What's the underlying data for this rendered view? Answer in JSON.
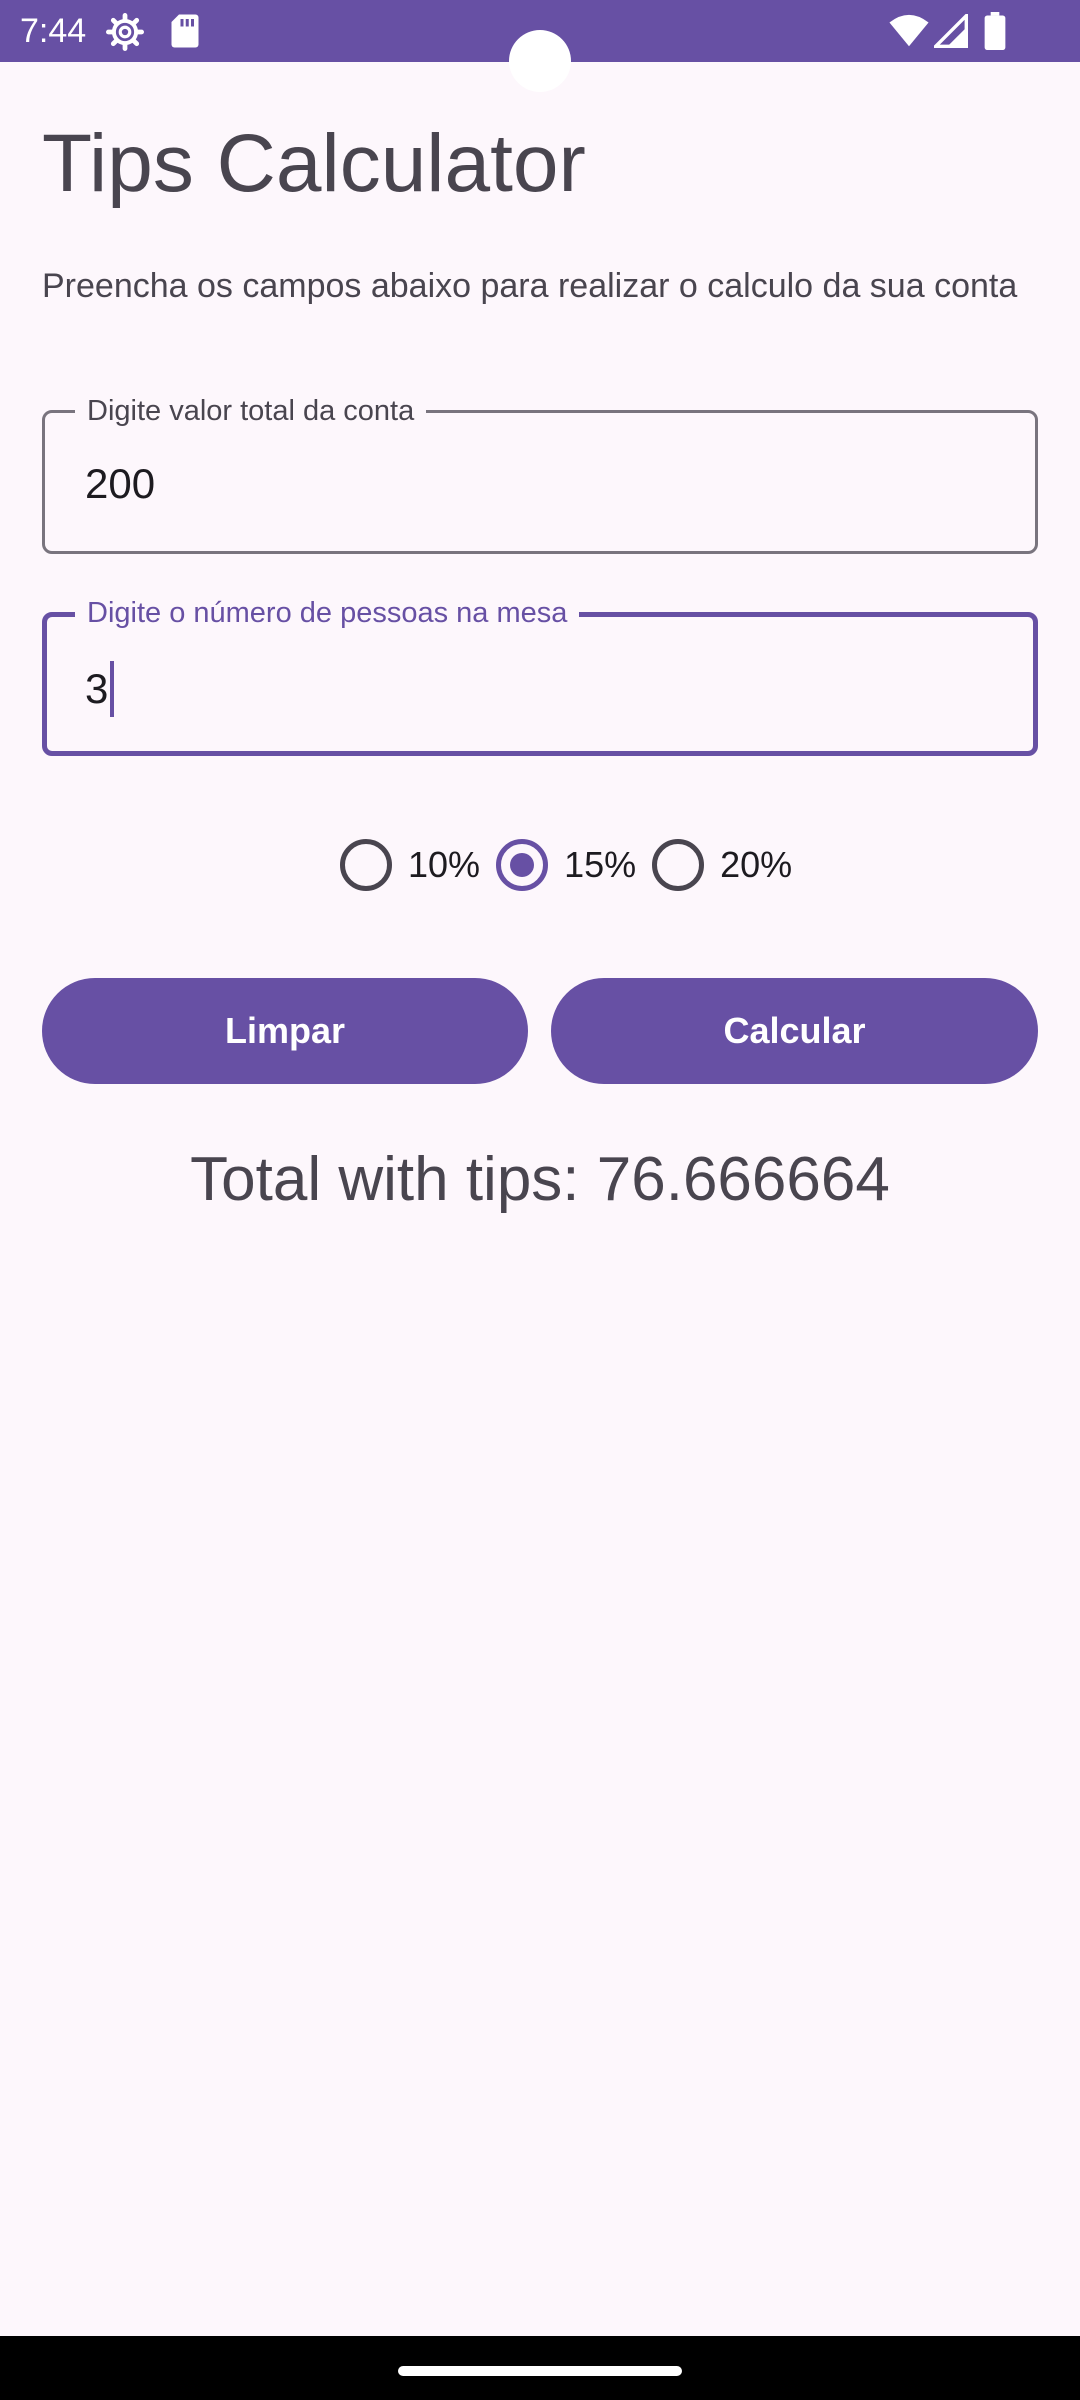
{
  "status_bar": {
    "time": "7:44",
    "icons": [
      "settings-gear-icon",
      "sd-card-icon",
      "wifi-icon",
      "cell-signal-icon",
      "battery-icon"
    ],
    "background": "#6750a4"
  },
  "app": {
    "title": "Tips Calculator",
    "instructions": "Preencha os campos abaixo para realizar o calculo da sua conta"
  },
  "fields": [
    {
      "label": "Digite valor total da conta",
      "value": "200",
      "focused": false
    },
    {
      "label": "Digite o número de pessoas na mesa",
      "value": "3",
      "focused": true
    }
  ],
  "tip_options": [
    {
      "label": "10%",
      "selected": false
    },
    {
      "label": "15%",
      "selected": true
    },
    {
      "label": "20%",
      "selected": false
    }
  ],
  "buttons": {
    "clear_label": "Limpar",
    "calculate_label": "Calcular"
  },
  "result": {
    "text": "Total with tips: 76.666664"
  },
  "colors": {
    "accent": "#6750a4",
    "background": "#fdf7fc",
    "text": "#49454f",
    "outline": "#79747e"
  }
}
